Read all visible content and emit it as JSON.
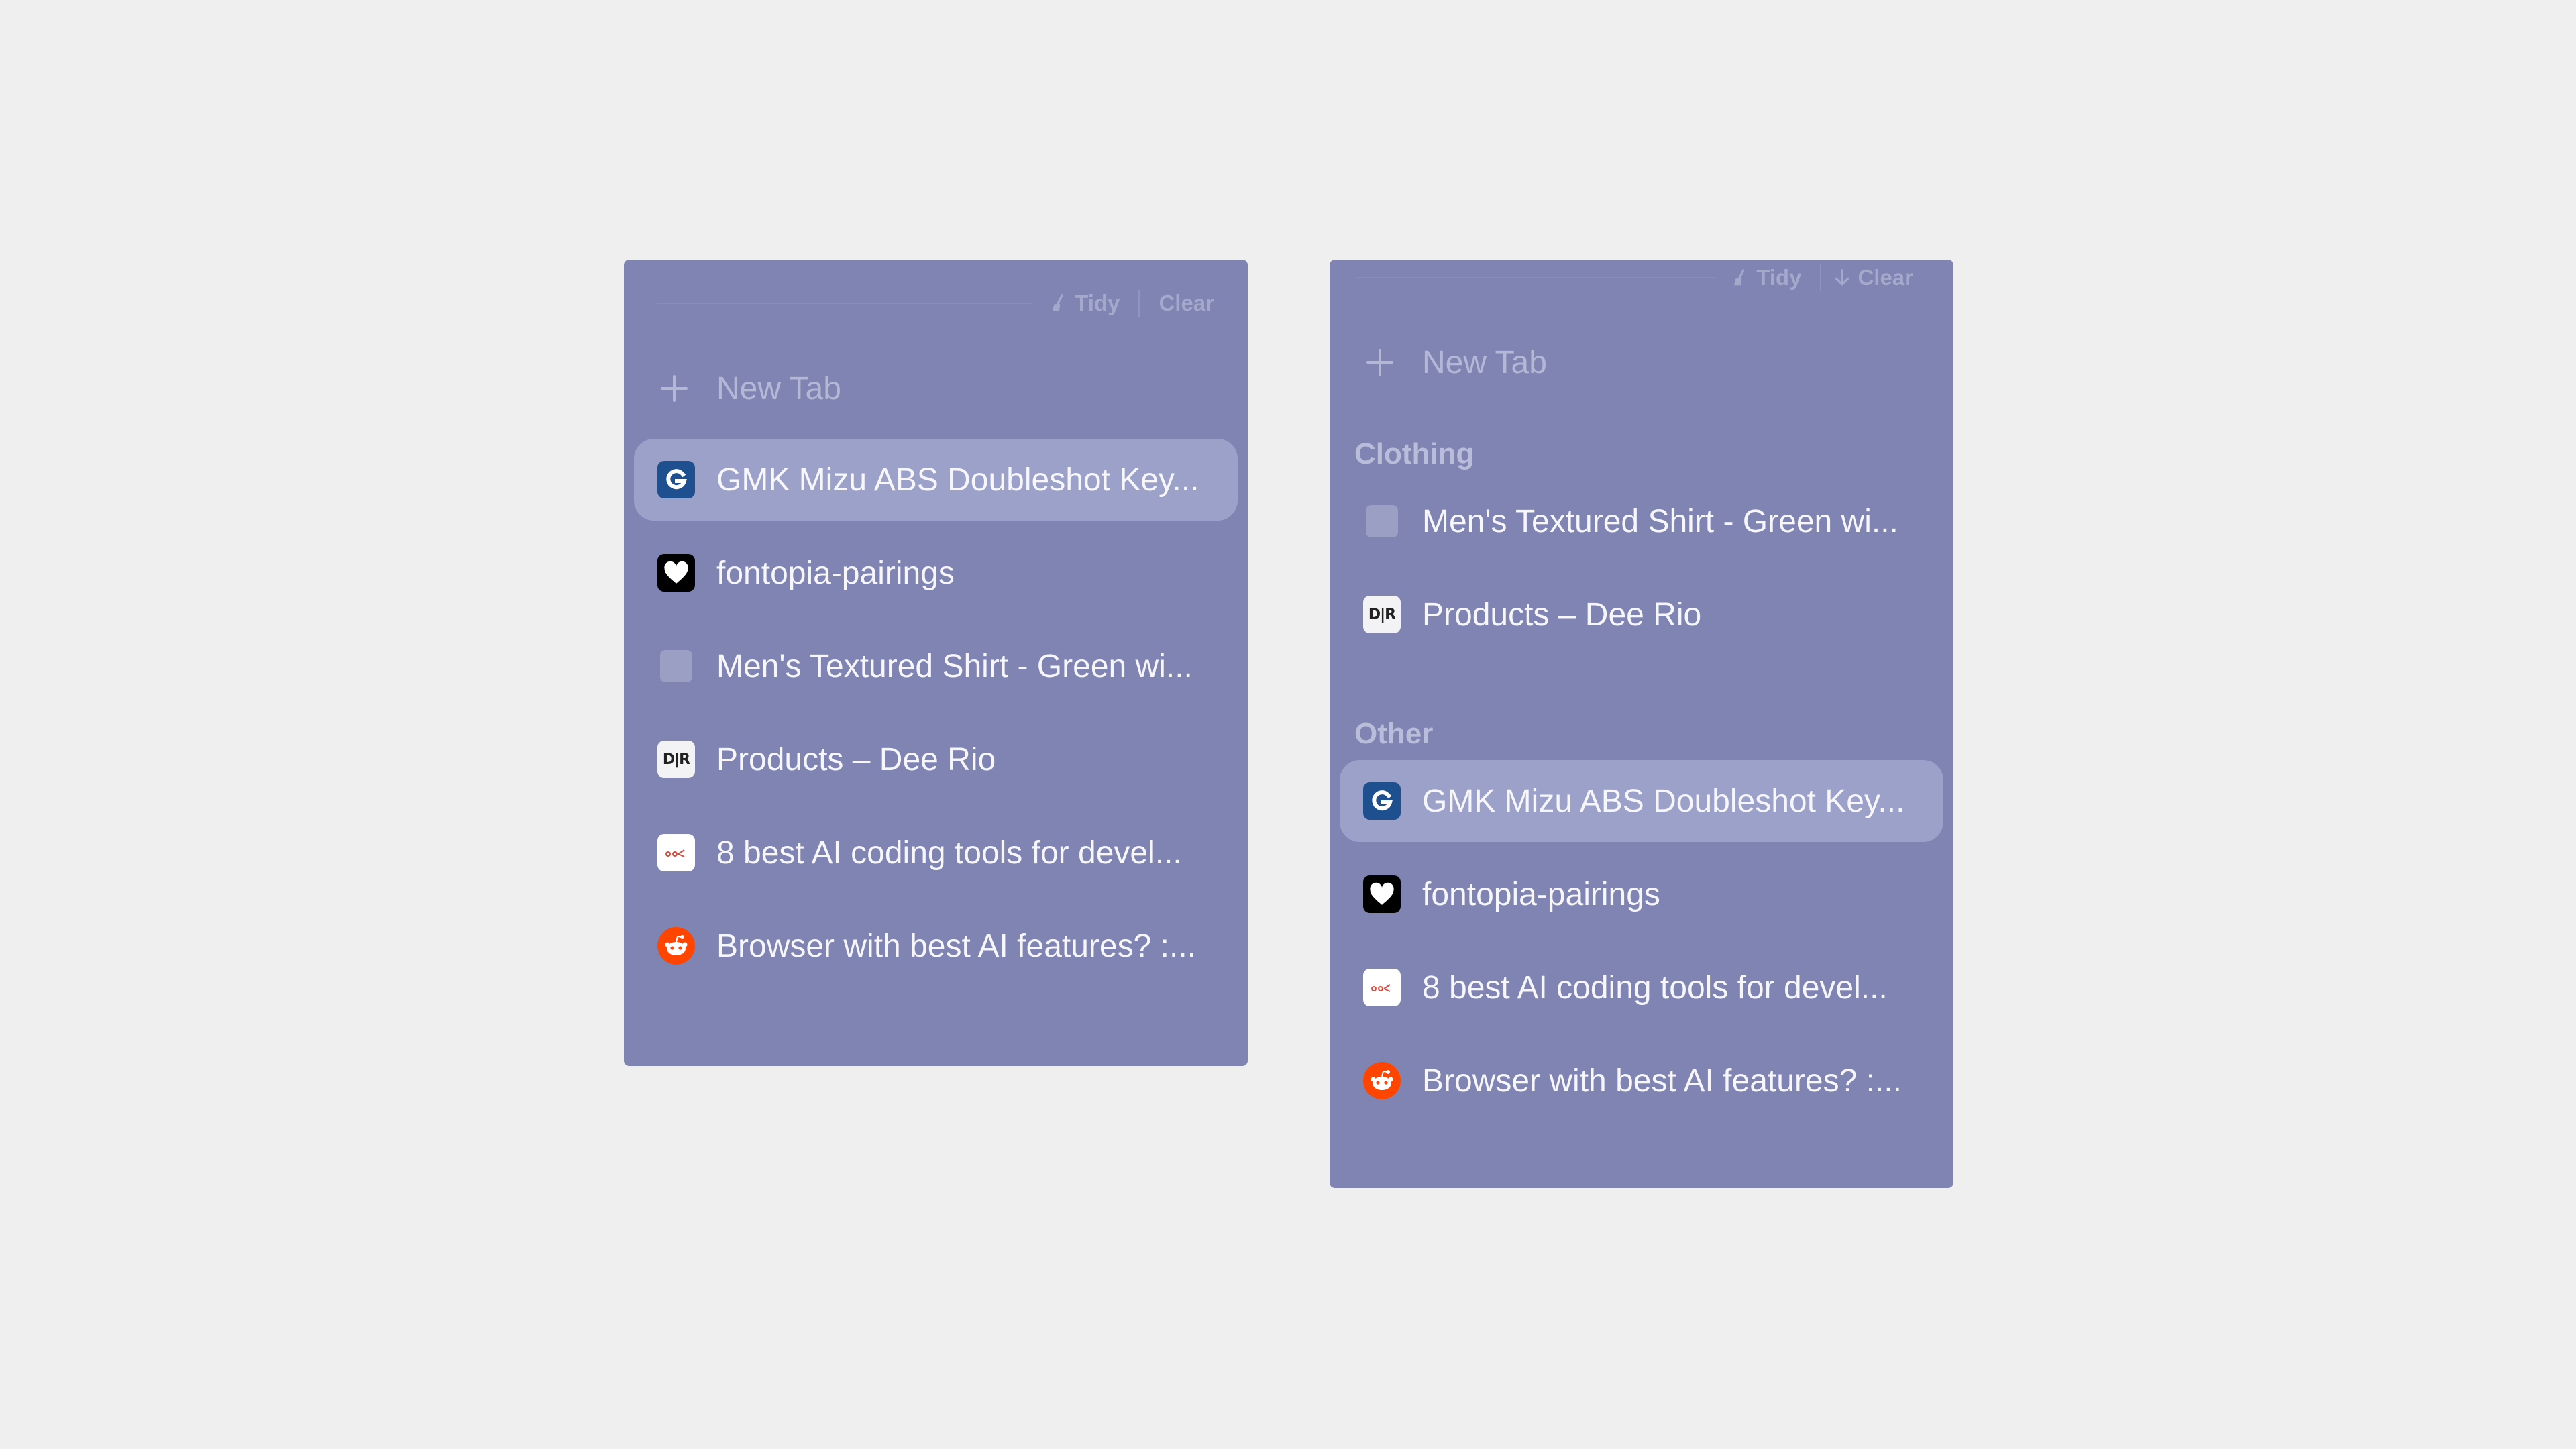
{
  "toolbar": {
    "tidy_label": "Tidy",
    "clear_label": "Clear"
  },
  "new_tab_label": "New Tab",
  "left_panel": {
    "tabs": [
      {
        "title": "GMK Mizu ABS Doubleshot Key...",
        "icon": "g-logo-icon",
        "active": true
      },
      {
        "title": "fontopia-pairings",
        "icon": "heart-icon",
        "active": false
      },
      {
        "title": "Men's Textured Shirt - Green wi...",
        "icon": "blank-favicon-icon",
        "active": false
      },
      {
        "title": "Products – Dee Rio",
        "icon": "dee-rio-logo-icon",
        "active": false
      },
      {
        "title": "8 best AI coding tools for devel...",
        "icon": "ai-tools-logo-icon",
        "active": false
      },
      {
        "title": "Browser with best AI features? :...",
        "icon": "reddit-icon",
        "active": false
      }
    ]
  },
  "right_panel": {
    "sections": [
      {
        "header": "Clothing",
        "tabs": [
          {
            "title": "Men's Textured Shirt - Green wi...",
            "icon": "blank-favicon-icon",
            "active": false
          },
          {
            "title": "Products – Dee Rio",
            "icon": "dee-rio-logo-icon",
            "active": false
          }
        ]
      },
      {
        "header": "Other",
        "tabs": [
          {
            "title": "GMK Mizu ABS Doubleshot Key...",
            "icon": "g-logo-icon",
            "active": true
          },
          {
            "title": "fontopia-pairings",
            "icon": "heart-icon",
            "active": false
          },
          {
            "title": "8 best AI coding tools for devel...",
            "icon": "ai-tools-logo-icon",
            "active": false
          },
          {
            "title": "Browser with best AI features? :...",
            "icon": "reddit-icon",
            "active": false
          }
        ]
      }
    ]
  },
  "favicon_texts": {
    "dee_rio": "D|R",
    "g": "G"
  },
  "colors": {
    "page_background": "#efefef",
    "panel_background": "#7f84b3",
    "active_tab": "#9ca1c9",
    "gmk_blue": "#1e4f8f",
    "reddit_orange": "#ff4500"
  }
}
